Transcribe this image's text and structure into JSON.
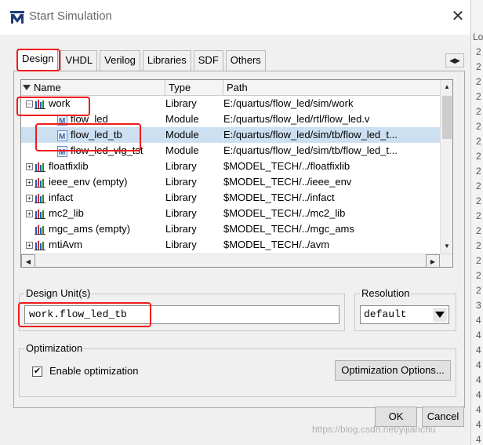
{
  "window": {
    "title": "Start Simulation",
    "close_glyph": "✕"
  },
  "tabs": [
    {
      "label": "Design",
      "active": true
    },
    {
      "label": "VHDL",
      "active": false
    },
    {
      "label": "Verilog",
      "active": false
    },
    {
      "label": "Libraries",
      "active": false
    },
    {
      "label": "SDF",
      "active": false
    },
    {
      "label": "Others",
      "active": false
    }
  ],
  "tab_scroll_glyph": "◀▶",
  "library_list": {
    "columns": {
      "name": "Name",
      "type": "Type",
      "path": "Path"
    },
    "rows": [
      {
        "name": "work",
        "type": "Library",
        "path": "E:/quartus/flow_led/sim/work",
        "icon": "library-icon",
        "expander": "−",
        "indent": 0,
        "selected": false
      },
      {
        "name": "flow_led",
        "type": "Module",
        "path": "E:/quartus/flow_led/rtl/flow_led.v",
        "icon": "module-icon",
        "expander": "",
        "indent": 1,
        "selected": false
      },
      {
        "name": "flow_led_tb",
        "type": "Module",
        "path": "E:/quartus/flow_led/sim/tb/flow_led_t...",
        "icon": "module-icon",
        "expander": "",
        "indent": 1,
        "selected": true
      },
      {
        "name": "flow_led_vlg_tst",
        "type": "Module",
        "path": "E:/quartus/flow_led/sim/tb/flow_led_t...",
        "icon": "module-icon",
        "expander": "",
        "indent": 1,
        "selected": false
      },
      {
        "name": "floatfixlib",
        "type": "Library",
        "path": "$MODEL_TECH/../floatfixlib",
        "icon": "library-icon",
        "expander": "+",
        "indent": 0,
        "selected": false
      },
      {
        "name": "ieee_env  (empty)",
        "type": "Library",
        "path": "$MODEL_TECH/../ieee_env",
        "icon": "library-icon",
        "expander": "+",
        "indent": 0,
        "selected": false
      },
      {
        "name": "infact",
        "type": "Library",
        "path": "$MODEL_TECH/../infact",
        "icon": "library-icon",
        "expander": "+",
        "indent": 0,
        "selected": false
      },
      {
        "name": "mc2_lib",
        "type": "Library",
        "path": "$MODEL_TECH/../mc2_lib",
        "icon": "library-icon",
        "expander": "+",
        "indent": 0,
        "selected": false
      },
      {
        "name": "mgc_ams  (empty)",
        "type": "Library",
        "path": "$MODEL_TECH/../mgc_ams",
        "icon": "library-icon",
        "expander": "",
        "indent": 0,
        "selected": false
      },
      {
        "name": "mtiAvm",
        "type": "Library",
        "path": "$MODEL_TECH/../avm",
        "icon": "library-icon",
        "expander": "+",
        "indent": 0,
        "selected": false
      }
    ]
  },
  "design_unit": {
    "label": "Design Unit(s)",
    "value": "work.flow_led_tb"
  },
  "resolution": {
    "label": "Resolution",
    "value": "default"
  },
  "optimization": {
    "label": "Optimization",
    "checkbox_label": "Enable optimization",
    "checked": true,
    "options_button": "Optimization Options..."
  },
  "buttons": {
    "ok": "OK",
    "cancel": "Cancel"
  },
  "right_strip": [
    "Lo",
    "2",
    "2",
    "2",
    "2",
    "2",
    "2",
    "2",
    "2",
    "2",
    "2",
    "2",
    "2",
    "2",
    "2",
    "2",
    "2",
    "2",
    "3",
    "4",
    "4",
    "4",
    "4",
    "4",
    "4",
    "4",
    "4",
    "4"
  ],
  "watermark": "https://blog.csdn.net/yijianchu",
  "colors": {
    "highlight": "#f21b1b",
    "selection": "#cde0f2",
    "dialog_bg": "#f0f0f0"
  }
}
